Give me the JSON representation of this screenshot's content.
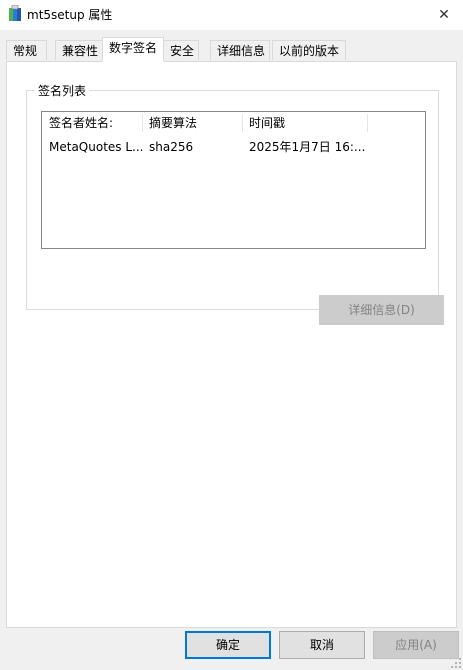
{
  "window": {
    "title": "mt5setup 属性",
    "close_glyph": "✕",
    "icon": "setup-package-icon"
  },
  "tabs": [
    {
      "label": "常规",
      "active": false
    },
    {
      "label": "兼容性",
      "active": false
    },
    {
      "label": "数字签名",
      "active": true
    },
    {
      "label": "安全",
      "active": false
    },
    {
      "label": "详细信息",
      "active": false
    },
    {
      "label": "以前的版本",
      "active": false
    }
  ],
  "signature_list": {
    "legend": "签名列表",
    "columns": [
      "签名者姓名:",
      "摘要算法",
      "时间戳"
    ],
    "rows": [
      {
        "signer": "MetaQuotes L...",
        "digest": "sha256",
        "timestamp": "2025年1月7日 16:..."
      }
    ],
    "details_button": "详细信息(D)"
  },
  "buttons": {
    "ok": "确定",
    "cancel": "取消",
    "apply": "应用(A)"
  },
  "colors": {
    "window_bg": "#f0f0f0",
    "panel_bg": "#ffffff",
    "focus_border": "#0078d7",
    "disabled_text": "#838383"
  }
}
